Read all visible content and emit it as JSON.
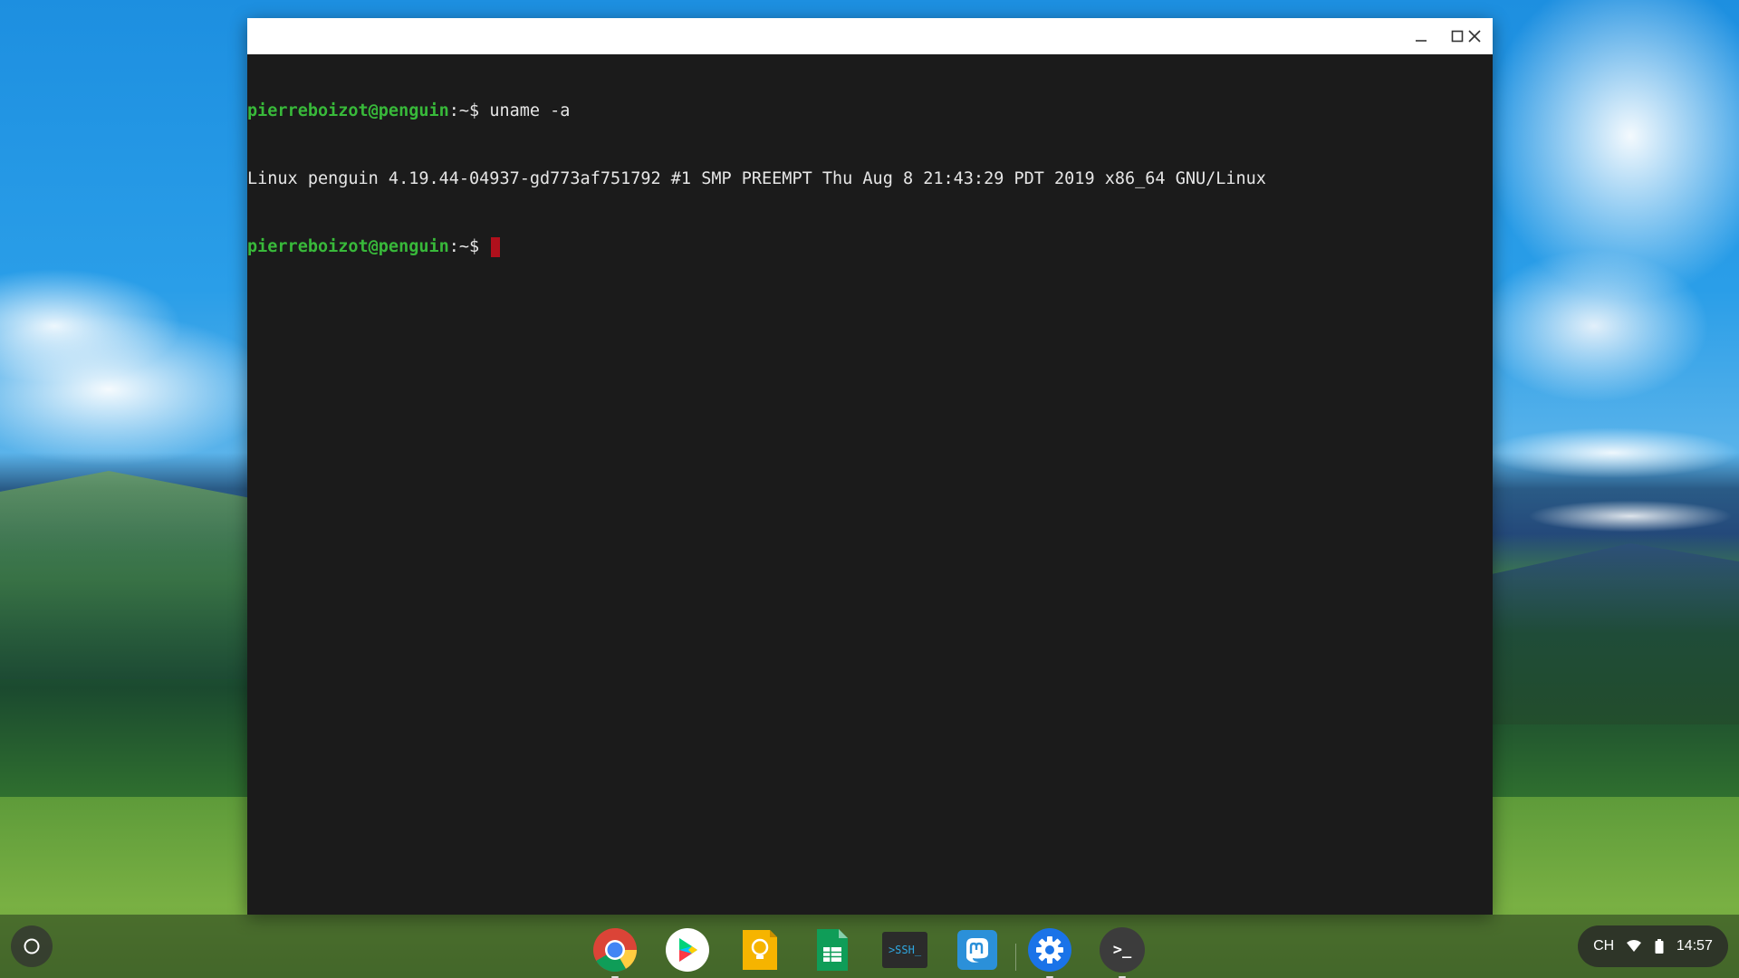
{
  "terminal": {
    "lines": [
      {
        "user_host": "pierreboizot@penguin",
        "path_prompt": ":~$ ",
        "command": "uname -a"
      },
      {
        "output": "Linux penguin 4.19.44-04937-gd773af751792 #1 SMP PREEMPT Thu Aug 8 21:43:29 PDT 2019 x86_64 GNU/Linux"
      },
      {
        "user_host": "pierreboizot@penguin",
        "path_prompt": ":~$ ",
        "command": ""
      }
    ]
  },
  "window_controls": {
    "minimize_icon": "minimize-icon",
    "maximize_icon": "maximize-icon",
    "close_icon": "close-icon"
  },
  "shelf": {
    "apps": [
      {
        "name": "Chrome",
        "icon": "chrome-icon",
        "running": true
      },
      {
        "name": "Play Store",
        "icon": "play-store-icon",
        "running": false
      },
      {
        "name": "Keep",
        "icon": "keep-icon",
        "running": false
      },
      {
        "name": "Sheets",
        "icon": "sheets-icon",
        "running": false
      },
      {
        "name": "Secure Shell",
        "icon": "ssh-icon",
        "label": ">SSH_",
        "running": false
      },
      {
        "name": "Mastodon",
        "icon": "mastodon-icon",
        "running": false
      },
      {
        "name": "Settings",
        "icon": "settings-icon",
        "running": true
      },
      {
        "name": "Terminal",
        "icon": "terminal-icon",
        "label": ">_",
        "running": true
      }
    ],
    "status": {
      "keyboard_layout": "CH",
      "time": "14:57"
    }
  }
}
